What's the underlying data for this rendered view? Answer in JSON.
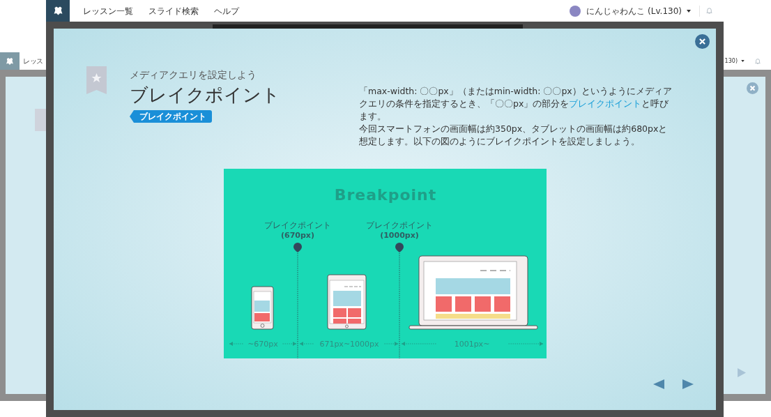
{
  "nav": {
    "items": [
      "レッスン一覧",
      "スライド検索",
      "ヘルプ"
    ],
    "user": "にんじゃわんこ (Lv.130)"
  },
  "background_copy": {
    "nav_item": "レッス",
    "user": "130)"
  },
  "slide": {
    "subtitle": "メディアクエリを設定しよう",
    "title": "ブレイクポイント",
    "tag": "ブレイクポイント",
    "paragraphs": [
      {
        "before": "「max-width: 〇〇px」（またはmin-width: 〇〇px）というようにメディアクエリの条件を指定するとき、「〇〇px」の部分を",
        "link": "ブレイクポイント",
        "after": "と呼びます。"
      },
      {
        "before": "今回スマートフォンの画面幅は約350px、タブレットの画面幅は約680pxと想定します。以下の図のようにブレイクポイントを設定しましょう。"
      }
    ]
  },
  "illustration": {
    "title": "Breakpoint",
    "markers": [
      {
        "label": "ブレイクポイント",
        "value": "(670px)"
      },
      {
        "label": "ブレイクポイント",
        "value": "(1000px)"
      }
    ],
    "ranges": [
      "~670px",
      "671px~1000px",
      "1001px~"
    ]
  }
}
